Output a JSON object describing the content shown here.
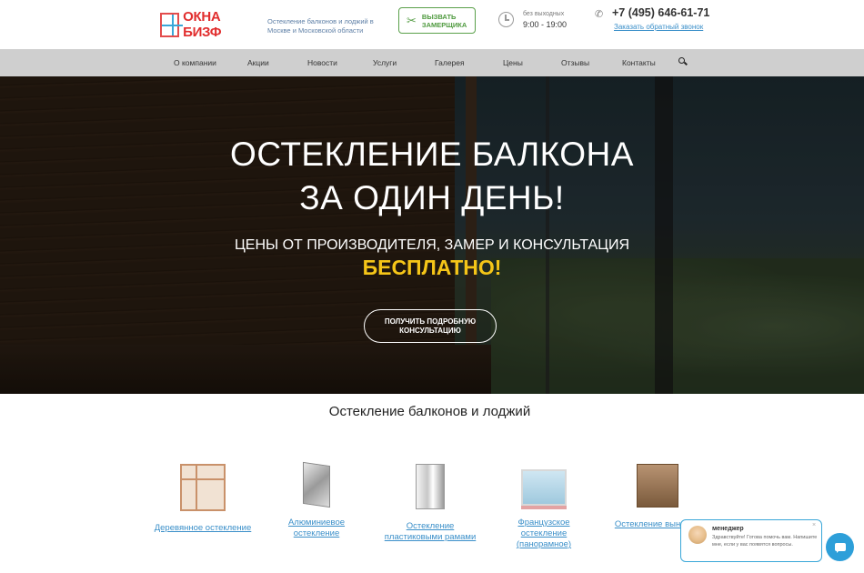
{
  "header": {
    "logo_text": "ОКНА БИЗФ",
    "tagline": "Остекление балконов и лоджий в Москве и Московской области",
    "measure_button": "ВЫЗВАТЬ ЗАМЕРЩИКА",
    "hours_label": "без выходных",
    "hours_value": "9:00 - 19:00",
    "phone": "+7 (495) 646-61-71",
    "callback_link": "Заказать обратный звонок"
  },
  "nav": {
    "items": [
      {
        "label": "О компании"
      },
      {
        "label": "Акции"
      },
      {
        "label": "Новости"
      },
      {
        "label": "Услуги"
      },
      {
        "label": "Галерея"
      },
      {
        "label": "Цены"
      },
      {
        "label": "Отзывы"
      },
      {
        "label": "Контакты"
      }
    ]
  },
  "hero": {
    "title_line1": "ОСТЕКЛЕНИЕ БАЛКОНА",
    "title_line2": "ЗА ОДИН ДЕНЬ!",
    "subtitle": "ЦЕНЫ ОТ ПРОИЗВОДИТЕЛЯ, ЗАМЕР И КОНСУЛЬТАЦИЯ",
    "free": "БЕСПЛАТНО!",
    "cta": "ПОЛУЧИТЬ ПОДРОБНУЮ КОНСУЛЬТАЦИЮ"
  },
  "section": {
    "title": "Остекление балконов и лоджий",
    "products": [
      {
        "label": "Деревянное остекление",
        "icon": "wooden-window-icon"
      },
      {
        "label": "Алюминиевое остекление",
        "icon": "aluminum-profile-icon"
      },
      {
        "label": "Остекление пластиковыми рамами",
        "icon": "pvc-profile-icon"
      },
      {
        "label": "Французское остекление (панорамное)",
        "icon": "french-balcony-icon"
      },
      {
        "label": "Остекление выносом",
        "icon": "extended-balcony-icon"
      }
    ]
  },
  "chat": {
    "name": "менеджер",
    "message": "Здравствуйте! Готова помочь вам. Напишите мне, если у вас появятся вопросы.",
    "close": "×"
  },
  "colors": {
    "nav_bg": "#cfcfcf",
    "accent_yellow": "#f5c518",
    "link_blue": "#3a8fc9",
    "green": "#5aa04a",
    "chat_blue": "#2d9fd9"
  }
}
